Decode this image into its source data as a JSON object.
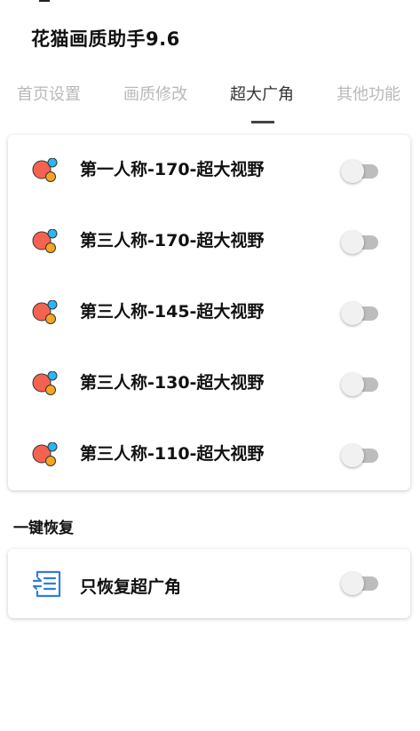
{
  "header": {
    "title": "花猫画质助手9.6"
  },
  "tabs": [
    {
      "label": "首页设置",
      "active": false
    },
    {
      "label": "画质修改",
      "active": false
    },
    {
      "label": "超大广角",
      "active": true
    },
    {
      "label": "其他功能",
      "active": false
    }
  ],
  "fov_options": [
    {
      "label": "第一人称-170-超大视野",
      "icon": "bubbles-icon",
      "enabled": false
    },
    {
      "label": "第三人称-170-超大视野",
      "icon": "bubbles-icon",
      "enabled": false
    },
    {
      "label": "第三人称-145-超大视野",
      "icon": "bubbles-icon",
      "enabled": false
    },
    {
      "label": "第三人称-130-超大视野",
      "icon": "bubbles-icon",
      "enabled": false
    },
    {
      "label": "第三人称-110-超大视野",
      "icon": "bubbles-icon",
      "enabled": false
    }
  ],
  "restore_section": {
    "title": "一键恢复",
    "item": {
      "label": "只恢复超广角",
      "icon": "restore-list-icon",
      "enabled": false
    }
  },
  "colors": {
    "bubble_red": "#f4634f",
    "bubble_orange": "#f6a523",
    "bubble_blue": "#29b6f6",
    "restore_icon_blue": "#2f7de1",
    "toggle_track_off": "#bdbdbd",
    "toggle_thumb_off": "#f1f1f1"
  }
}
